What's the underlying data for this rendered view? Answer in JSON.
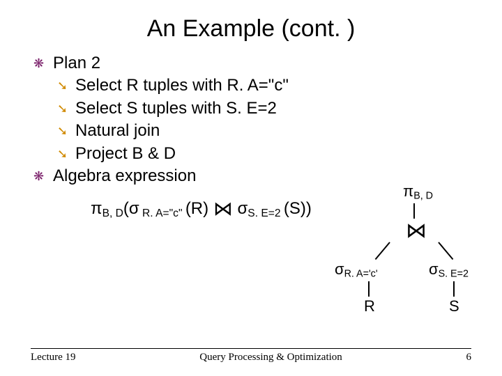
{
  "title": "An Example (cont. )",
  "bullets": {
    "plan": "Plan 2",
    "step1": "Select R tuples with R. A=\"c\"",
    "step2": "Select S tuples with S. E=2",
    "step3": "Natural join",
    "step4": "Project B & D",
    "algebra": "Algebra expression"
  },
  "expr": {
    "pi": "π",
    "pi_sub": "B, D",
    "sigma": "σ",
    "lparen": "(",
    "sig1_sub": " R. A=\"c\" ",
    "R_paren": "(R)",
    "join": "⋈",
    "sig2_sub": "S. E=2 ",
    "S_paren": "(S))"
  },
  "tree": {
    "top_pi": "π",
    "top_sub": "B, D",
    "join": "⋈",
    "sigL": "σ",
    "sigL_sub": "R. A='c'",
    "sigR": "σ",
    "sigR_sub": "S. E=2",
    "R": "R",
    "S": "S"
  },
  "footer": {
    "left": "Lecture 19",
    "center": "Query Processing & Optimization",
    "right": "6"
  }
}
